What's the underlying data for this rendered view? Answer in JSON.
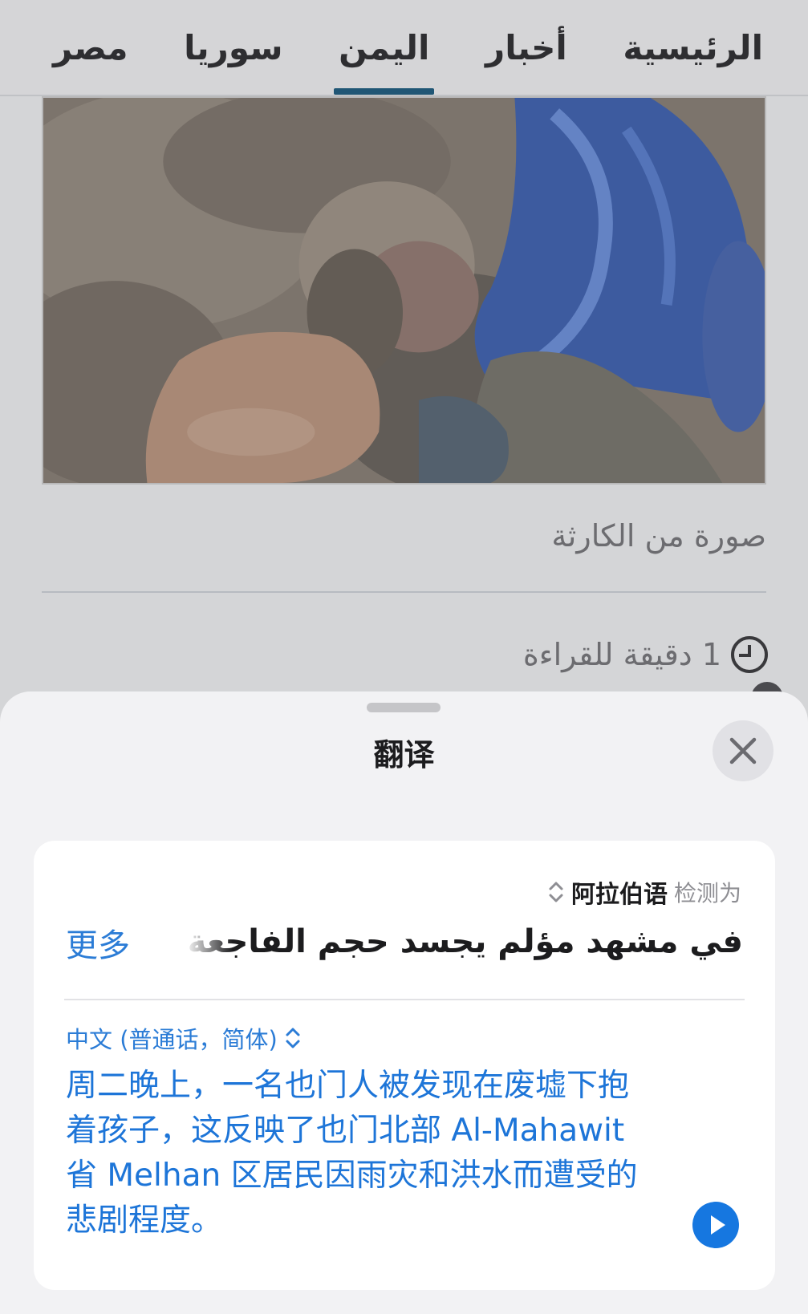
{
  "nav": {
    "tabs": [
      {
        "label": "الرئيسية",
        "active": false
      },
      {
        "label": "أخبار",
        "active": false
      },
      {
        "label": "اليمن",
        "active": true
      },
      {
        "label": "سوريا",
        "active": false
      },
      {
        "label": "مصر",
        "active": false
      }
    ],
    "active_color": "#0a4e73"
  },
  "article": {
    "image_caption": "صورة من الكارثة",
    "read_time": "1 دقيقة للقراءة",
    "read_time_icon": "clock-icon"
  },
  "translate_sheet": {
    "title": "翻译",
    "close_icon": "close-icon",
    "source": {
      "detected_label": "检测为",
      "language": "阿拉伯语",
      "text": "في مشهد مؤلم يجسد حجم الفاجعة التي",
      "more_label": "更多"
    },
    "target": {
      "language": "中文 (普通话，简体)",
      "text": "周二晚上，一名也门人被发现在废墟下抱着孩子，这反映了也门北部 Al-Mahawit 省 Melhan 区居民因雨灾和洪水而遭受的悲剧程度。"
    },
    "play_icon": "play-icon",
    "accent_color": "#2b7cd6"
  }
}
